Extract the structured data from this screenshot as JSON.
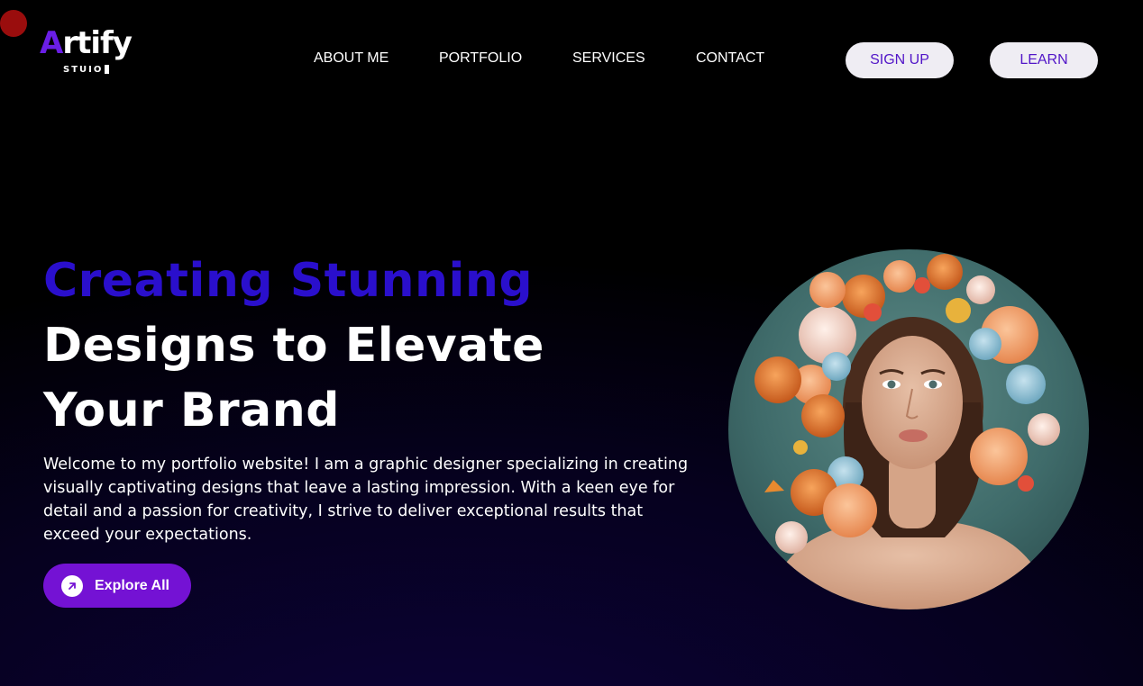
{
  "brand": {
    "logo_first_letter": "A",
    "logo_rest": "rtify",
    "logo_sub": "STUIO",
    "accent_color": "#6a1ee6"
  },
  "nav": {
    "items": [
      {
        "label": "ABOUT ME"
      },
      {
        "label": "PORTFOLIO"
      },
      {
        "label": "SERVICES"
      },
      {
        "label": "CONTACT"
      }
    ],
    "signup_label": "SIGN UP",
    "learn_label": "LEARN"
  },
  "hero": {
    "title_accent": "Creating Stunning",
    "title_line2": "Designs to Elevate",
    "title_line3": "Your Brand",
    "description": "Welcome to my portfolio website! I am a graphic designer specializing in creating visually captivating designs that leave a lasting impression. With a keen eye for detail and a passion for creativity, I strive to deliver exceptional results that exceed your expectations.",
    "cta_label": "Explore All",
    "cta_icon": "arrow-up-right-icon",
    "accent_color": "#2a0fcc",
    "cta_color": "#7412d4"
  },
  "portrait": {
    "icon": "woman-with-flowers-portrait"
  }
}
